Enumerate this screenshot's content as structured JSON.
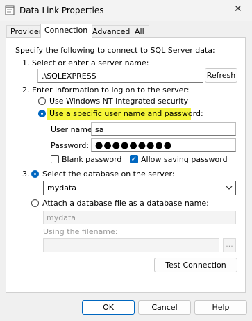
{
  "window": {
    "title": "Data Link Properties",
    "close_glyph": "✕",
    "icon": "data-link-app-icon"
  },
  "tabs": [
    {
      "label": "Provider"
    },
    {
      "label": "Connection"
    },
    {
      "label": "Advanced"
    },
    {
      "label": "All"
    }
  ],
  "connection": {
    "intro": "Specify the following to connect to SQL Server data:",
    "step1": {
      "label": "1. Select or enter a server name:",
      "server_value": ".\\SQLEXPRESS",
      "refresh_label": "Refresh"
    },
    "step2": {
      "label": "2. Enter information to log on to the server:",
      "windows_auth_label": "Use Windows NT Integrated security",
      "specific_user_label": "Use a specific user name and password:",
      "username_label": "User name:",
      "username_value": "sa",
      "password_label": "Password:",
      "password_value": "●●●●●●●●●",
      "blank_password_label": "Blank password",
      "allow_saving_label": "Allow saving password",
      "allow_saving_checked": true,
      "blank_password_checked": false
    },
    "step3": {
      "number": "3.",
      "select_db_label": "Select the database on the server:",
      "database_value": "mydata",
      "attach_label": "Attach a database file as a database name:",
      "attach_name_value": "mydata",
      "filename_label": "Using the filename:",
      "browse_label": "..."
    },
    "test_button_label": "Test Connection"
  },
  "footer": {
    "ok_label": "OK",
    "cancel_label": "Cancel",
    "help_label": "Help"
  },
  "colors": {
    "accent": "#0067c0",
    "highlight": "#f5f53a"
  }
}
